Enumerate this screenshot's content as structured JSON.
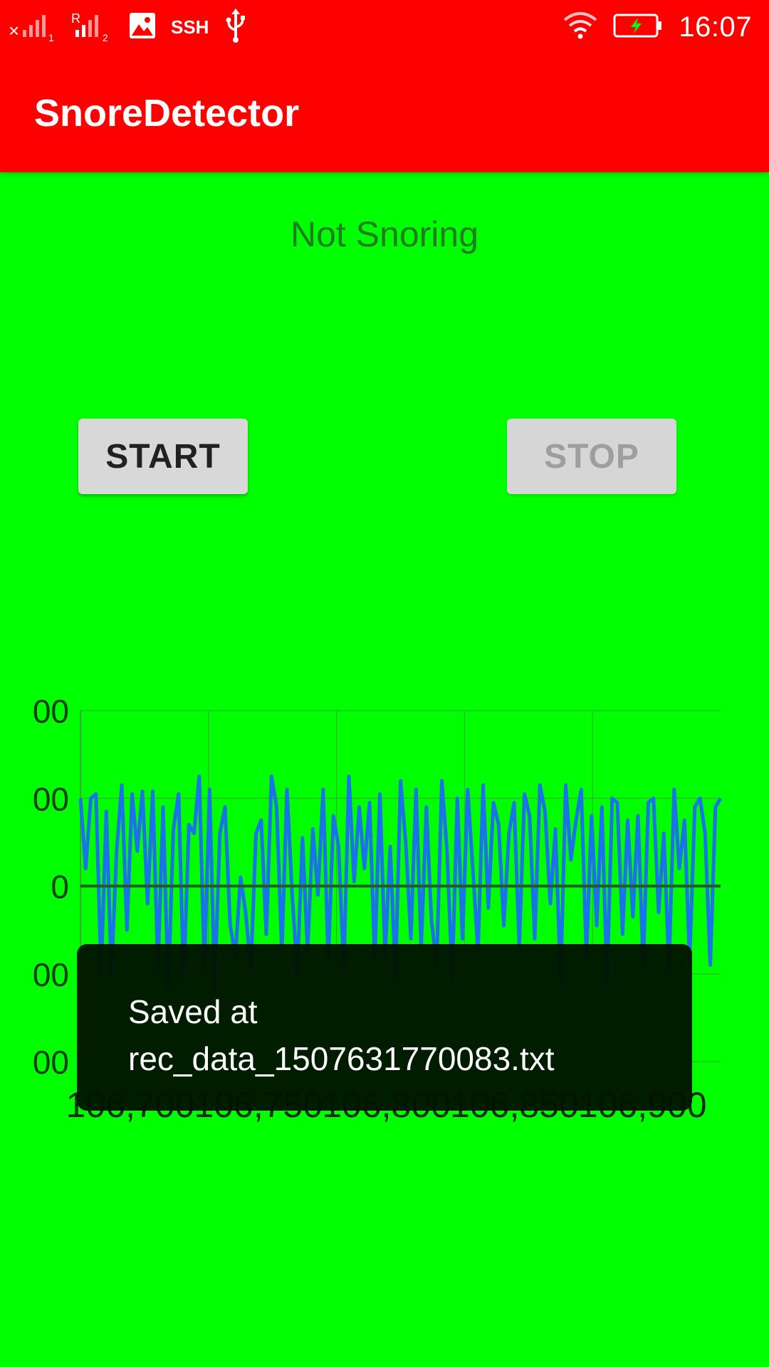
{
  "status_bar": {
    "sim1_icon": "signal-x-sim1-icon",
    "sim2_icon": "signal-roaming-sim2-icon",
    "gallery_icon": "image-icon",
    "ssh_label": "SSH",
    "usb_icon": "usb-icon",
    "wifi_icon": "wifi-icon",
    "battery_icon": "battery-charging-icon",
    "time": "16:07"
  },
  "app_bar": {
    "title": "SnoreDetector",
    "background_color": "#ff0000"
  },
  "main": {
    "background_color": "#00ff00",
    "status_text": "Not Snoring",
    "start_button": "START",
    "stop_button": "STOP"
  },
  "chart_data": {
    "type": "line",
    "line_color": "#1a73e8",
    "y_tick_labels": [
      "00",
      "00",
      "0",
      "00",
      "00"
    ],
    "y_ticks": [
      200,
      100,
      0,
      -100,
      -200
    ],
    "ylim": [
      -200,
      200
    ],
    "x_tick_labels": [
      "106,700",
      "106,750",
      "106,800",
      "106,850",
      "106,900"
    ],
    "x_ticks": [
      106700,
      106750,
      106800,
      106850,
      106900
    ],
    "xlim": [
      106700,
      106950
    ],
    "grid": true,
    "series": [
      {
        "values": [
          100,
          20,
          100,
          105,
          -100,
          85,
          -100,
          40,
          115,
          -50,
          105,
          40,
          108,
          -20,
          108,
          -95,
          90,
          -120,
          65,
          105,
          -110,
          70,
          60,
          125,
          -95,
          110,
          -115,
          60,
          90,
          -45,
          -80,
          10,
          -30,
          -95,
          60,
          75,
          -55,
          125,
          90,
          -75,
          110,
          -10,
          -100,
          55,
          -75,
          65,
          -10,
          110,
          -85,
          80,
          45,
          -95,
          125,
          5,
          90,
          20,
          95,
          -85,
          105,
          -80,
          45,
          -105,
          120,
          50,
          -60,
          110,
          -70,
          90,
          -40,
          -90,
          120,
          40,
          -105,
          100,
          -60,
          110,
          20,
          -75,
          115,
          -25,
          95,
          70,
          -45,
          60,
          95,
          -70,
          105,
          80,
          -60,
          115,
          85,
          -20,
          65,
          -110,
          115,
          30,
          75,
          110,
          -80,
          80,
          -45,
          90,
          -110,
          100,
          95,
          -55,
          75,
          -35,
          80,
          -90,
          95,
          100,
          -30,
          60,
          -95,
          110,
          20,
          75,
          -85,
          90,
          100,
          60,
          -90,
          90,
          100
        ]
      }
    ]
  },
  "toast": {
    "line1": "Saved at",
    "line2": "rec_data_1507631770083.txt"
  }
}
